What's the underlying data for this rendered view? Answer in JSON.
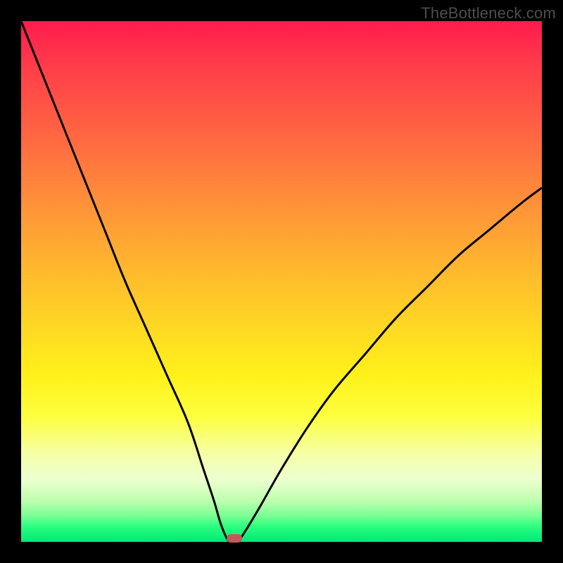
{
  "watermark": "TheBottleneck.com",
  "colors": {
    "frame_border": "#000000",
    "curve_stroke": "#000000",
    "marker_fill": "#c05a5a",
    "gradient_top": "#ff1a4d",
    "gradient_bottom": "#00e876"
  },
  "chart_data": {
    "type": "line",
    "title": "",
    "xlabel": "",
    "ylabel": "",
    "xlim": [
      0,
      100
    ],
    "ylim": [
      0,
      100
    ],
    "grid": false,
    "legend": false,
    "series": [
      {
        "name": "bottleneck-curve",
        "x": [
          0,
          4,
          8,
          12,
          16,
          20,
          24,
          28,
          32,
          35,
          37,
          38.5,
          40,
          41.5,
          43,
          46,
          50,
          55,
          60,
          66,
          72,
          78,
          84,
          90,
          96,
          100
        ],
        "y": [
          100,
          90,
          80,
          70,
          60,
          50,
          41,
          32,
          23,
          14,
          8,
          3,
          0,
          0,
          2,
          7,
          14,
          22,
          29,
          36,
          43,
          49,
          55,
          60,
          65,
          68
        ]
      }
    ],
    "annotations": [
      {
        "name": "optimal-marker",
        "x": 41,
        "y": 0,
        "shape": "rounded-rect",
        "color": "#c05a5a"
      }
    ]
  }
}
